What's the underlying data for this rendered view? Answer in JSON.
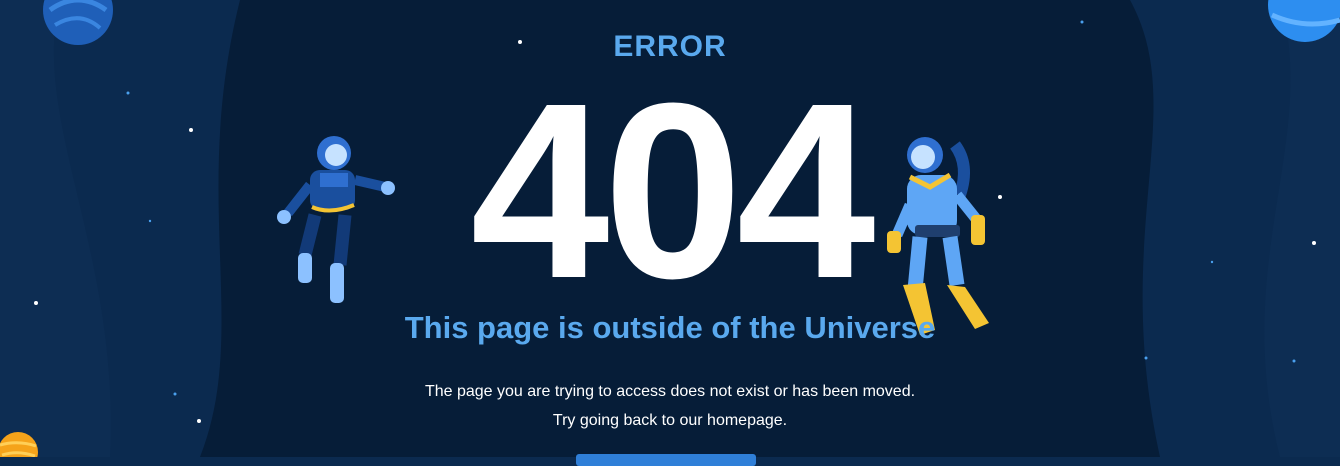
{
  "error_label": "ERROR",
  "code": "404",
  "headline": "This page is outside of the Universe",
  "message_line1": "The page you are trying to access does not exist or has been moved.",
  "message_line2": "Try going back to our homepage.",
  "colors": {
    "background": "#0b2a4f",
    "center_panel": "#061d38",
    "accent": "#5aa9ee",
    "button": "#2f7fd8"
  }
}
